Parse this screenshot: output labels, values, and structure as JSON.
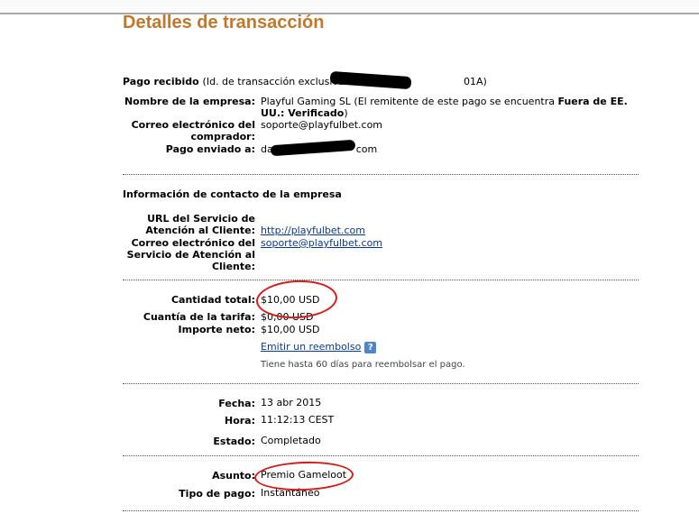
{
  "title": "Detalles de transacción",
  "payment_received": {
    "label": "Pago recibido",
    "detail_prefix": "(Id. de transacción exclusivo n.º 52R",
    "detail_suffix": "01A)"
  },
  "company_fields": {
    "name_label": "Nombre de la empresa:",
    "name_value_prefix": "Playful Gaming SL (El remitente de este pago se encuentra ",
    "name_value_bold": "Fuera de EE. UU.: Verificado",
    "name_value_suffix": ")",
    "buyer_email_label": "Correo electrónico del comprador:",
    "buyer_email_value": "soporte@playfulbet.com",
    "sent_to_label": "Pago enviado a:",
    "sent_to_prefix": "da",
    "sent_to_suffix": "com"
  },
  "contact": {
    "heading": "Información de contacto de la empresa",
    "url_label": "URL del Servicio de Atención al Cliente:",
    "url_value": "http://playfulbet.com",
    "email_label": "Correo electrónico del Servicio de Atención al Cliente:",
    "email_value": "soporte@playfulbet.com"
  },
  "amounts": {
    "total_label": "Cantidad total:",
    "total_value": "$10,00 USD",
    "fee_label": "Cuantía de la tarifa:",
    "fee_value": "$0,00 USD",
    "net_label": "Importe neto:",
    "net_value": "$10,00 USD",
    "refund_link": "Emitir un reembolso",
    "help_icon": "?",
    "refund_note": "Tiene hasta 60 días para reembolsar el pago."
  },
  "details": {
    "date_label": "Fecha:",
    "date_value": "13 abr 2015",
    "time_label": "Hora:",
    "time_value": "11:12:13 CEST",
    "status_label": "Estado:",
    "status_value": "Completado"
  },
  "subject": {
    "subject_label": "Asunto:",
    "subject_value": "Premio Gameloot",
    "type_label": "Tipo de pago:",
    "type_value": "Instantáneo"
  },
  "colors": {
    "title": "#c0782d",
    "link": "#0b3a8c",
    "annotation": "#d21b1b"
  }
}
